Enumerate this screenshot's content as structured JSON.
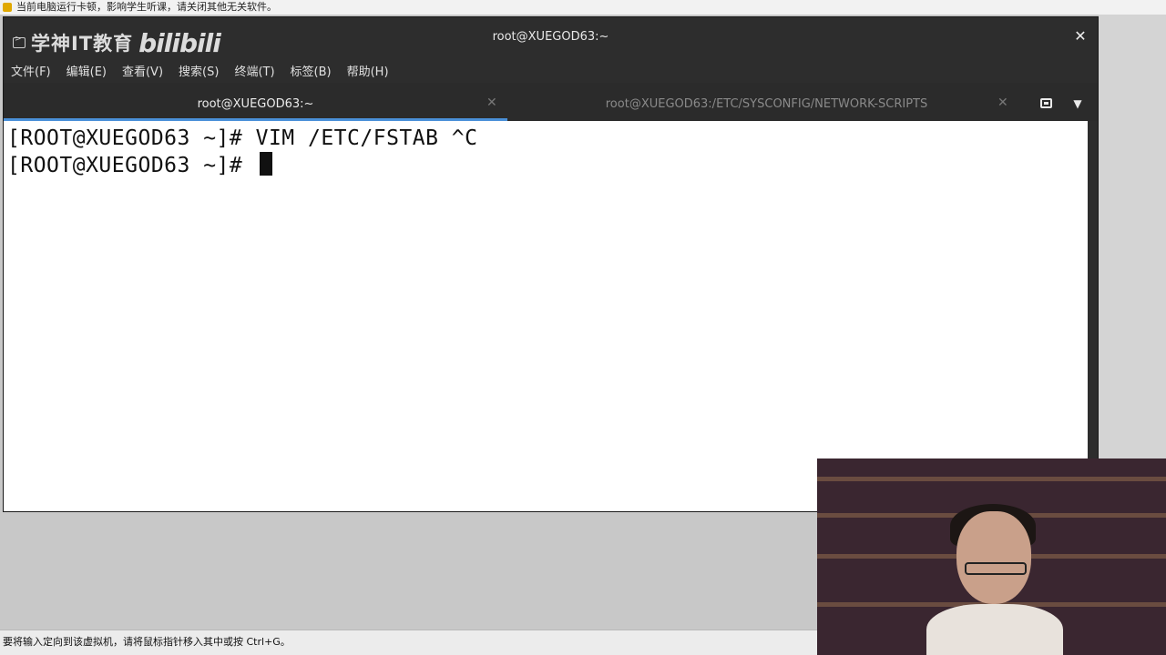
{
  "notice": {
    "text": "当前电脑运行卡顿，影响学生听课，请关闭其他无关软件。"
  },
  "window": {
    "title": "root@XUEGOD63:~",
    "watermark_brand": "学神IT教育",
    "watermark_logo": "bilibili"
  },
  "menu": {
    "items": [
      "文件(F)",
      "编辑(E)",
      "查看(V)",
      "搜索(S)",
      "终端(T)",
      "标签(B)",
      "帮助(H)"
    ]
  },
  "tabs": [
    {
      "label": "root@XUEGOD63:~",
      "active": true
    },
    {
      "label": "root@XUEGOD63:/ETC/SYSCONFIG/NETWORK-SCRIPTS",
      "active": false
    }
  ],
  "icons": {
    "close": "close-icon",
    "new_tab": "new-tab-icon",
    "tab_menu": "chevron-down-icon"
  },
  "terminal": {
    "lines": [
      "[ROOT@XUEGOD63 ~]# VIM /ETC/FSTAB ^C",
      "[ROOT@XUEGOD63 ~]# "
    ]
  },
  "statusbar": {
    "text": "要将输入定向到该虚拟机，请将鼠标指针移入其中或按 Ctrl+G。"
  },
  "colors": {
    "accent": "#4a90d9",
    "terminal_bg": "#ffffff",
    "chrome_bg": "#2d2d2d"
  }
}
